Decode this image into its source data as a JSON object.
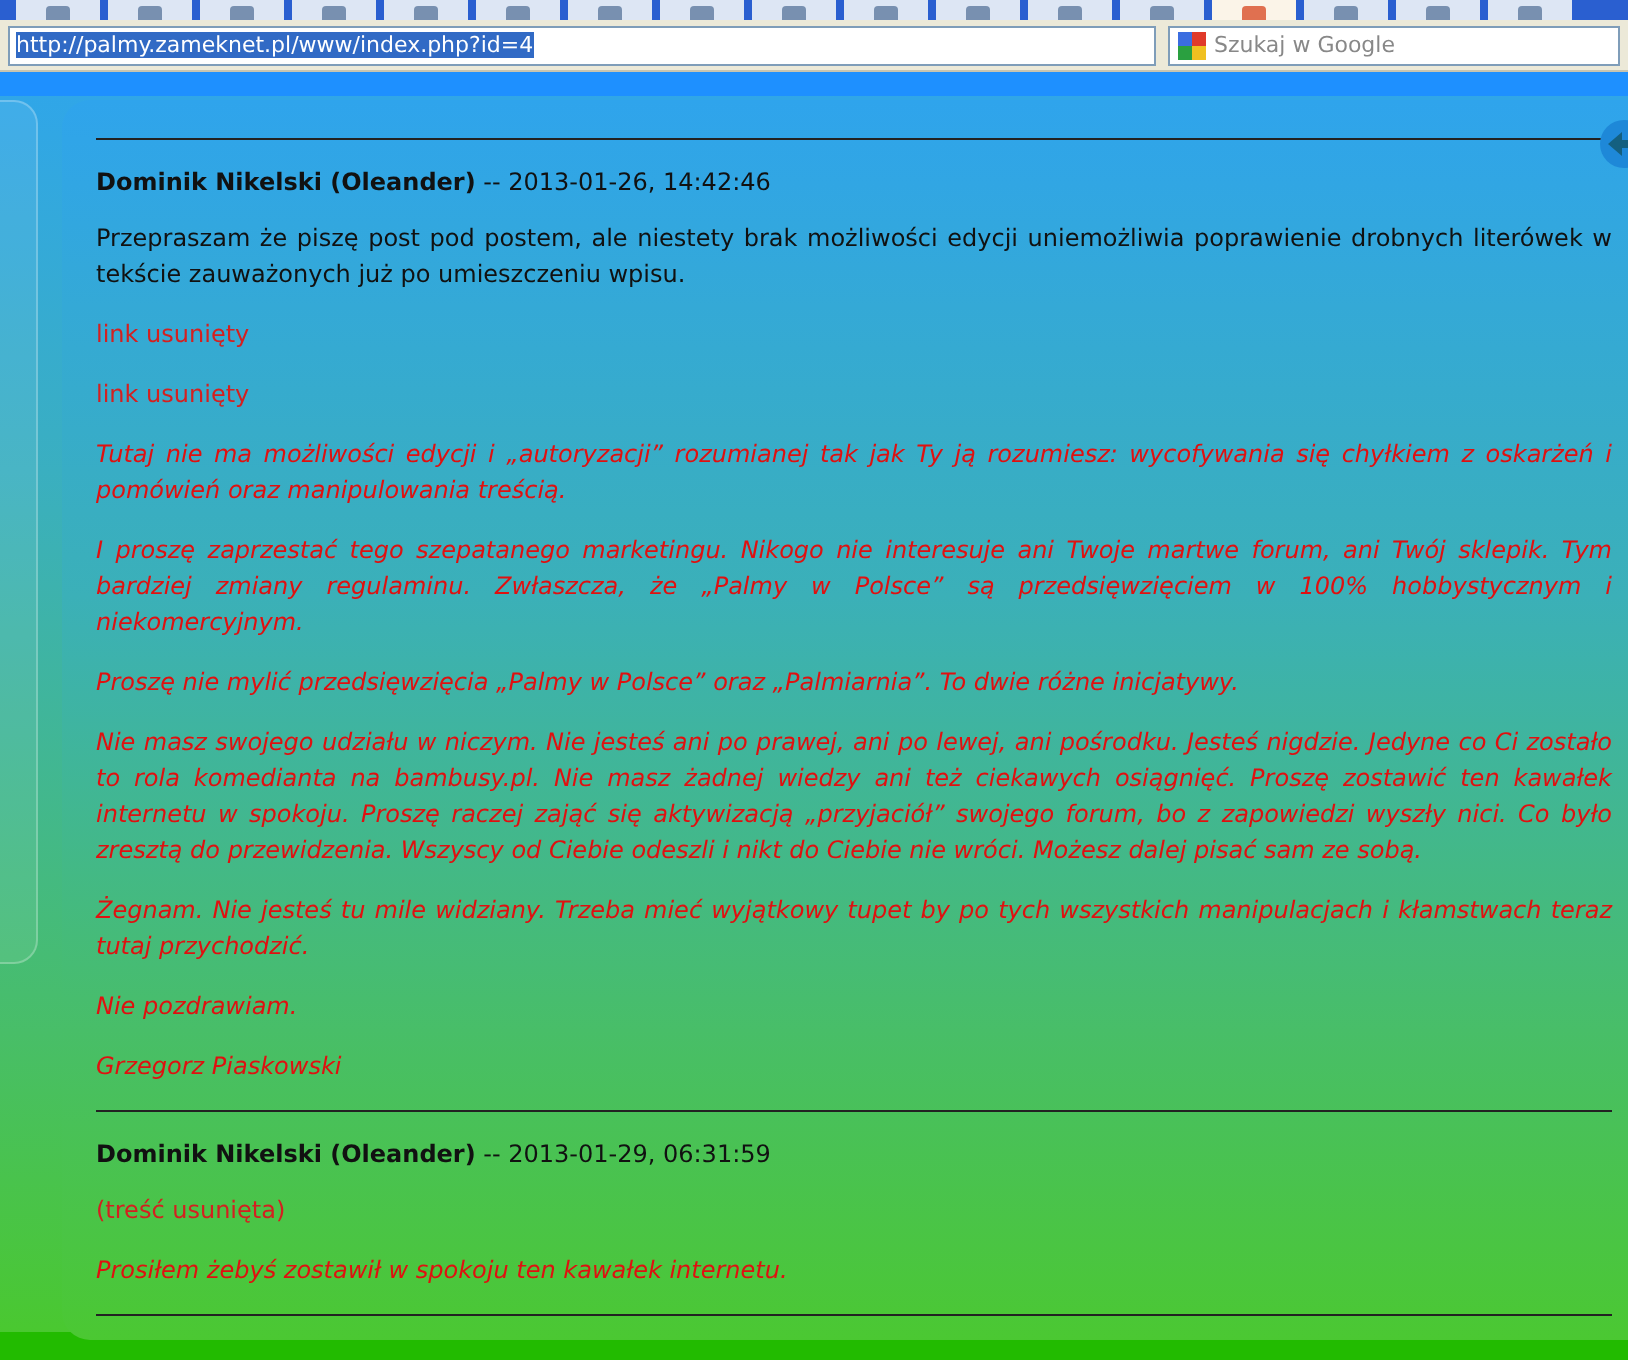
{
  "browser": {
    "tabs": [
      {
        "selected": false
      },
      {
        "selected": false
      },
      {
        "selected": false
      },
      {
        "selected": false
      },
      {
        "selected": false
      },
      {
        "selected": false
      },
      {
        "selected": false
      },
      {
        "selected": false
      },
      {
        "selected": false
      },
      {
        "selected": false
      },
      {
        "selected": false
      },
      {
        "selected": false
      },
      {
        "selected": false
      },
      {
        "selected": true
      },
      {
        "selected": false
      },
      {
        "selected": false
      },
      {
        "selected": false
      }
    ],
    "url": "http://palmy.zameknet.pl/www/index.php?id=4",
    "search_placeholder": "Szukaj w Google"
  },
  "posts": [
    {
      "author": "Dominik Nikelski (Oleander)",
      "date": "-- 2013-01-26, 14:42:46",
      "paragraphs": [
        {
          "kind": "normal",
          "text": "Przepraszam że piszę post pod postem, ale niestety brak możliwości edycji uniemożliwia poprawienie drobnych literówek w tekście zauważonych już po umieszczeniu wpisu."
        },
        {
          "kind": "removed",
          "text": "link usunięty"
        },
        {
          "kind": "removed",
          "text": "link usunięty"
        },
        {
          "kind": "quote",
          "text": "Tutaj nie ma możliwości edycji i „autoryzacji” rozumianej tak jak Ty ją rozumiesz: wycofywania się chyłkiem z oskarżeń i pomówień oraz manipulowania treścią."
        },
        {
          "kind": "quote",
          "text": "I proszę zaprzestać tego szepatanego marketingu. Nikogo nie interesuje ani Twoje martwe forum, ani Twój sklepik. Tym bardziej zmiany regulaminu. Zwłaszcza, że „Palmy w Polsce” są przedsięwzięciem w 100% hobbystycznym i niekomercyjnym."
        },
        {
          "kind": "quote",
          "text": "Proszę nie mylić przedsięwzięcia „Palmy w Polsce” oraz „Palmiarnia”. To dwie różne inicjatywy."
        },
        {
          "kind": "quote",
          "text": "Nie masz swojego udziału w niczym. Nie jesteś ani po prawej, ani po lewej, ani pośrodku. Jesteś nigdzie. Jedyne co Ci zostało to rola komedianta na bambusy.pl. Nie masz żadnej wiedzy ani też ciekawych osiągnięć. Proszę zostawić ten kawałek internetu w spokoju. Proszę raczej zająć się aktywizacją „przyjaciół” swojego forum, bo z zapowiedzi wyszły nici. Co było zresztą do przewidzenia. Wszyscy od Ciebie odeszli i nikt do Ciebie nie wróci. Możesz dalej pisać sam ze sobą."
        },
        {
          "kind": "quote",
          "text": "Żegnam. Nie jesteś tu mile widziany. Trzeba mieć wyjątkowy tupet by po tych wszystkich manipulacjach i kłamstwach teraz tutaj przychodzić."
        },
        {
          "kind": "quote",
          "text": "Nie pozdrawiam."
        },
        {
          "kind": "quote",
          "text": "Grzegorz Piaskowski"
        }
      ]
    },
    {
      "author": "Dominik Nikelski (Oleander)",
      "date": "-- 2013-01-29, 06:31:59",
      "paragraphs": [
        {
          "kind": "removed",
          "text": "(treść usunięta)"
        },
        {
          "kind": "quote",
          "text": "Prosiłem żebyś zostawił w spokoju ten kawałek internetu."
        }
      ]
    }
  ]
}
